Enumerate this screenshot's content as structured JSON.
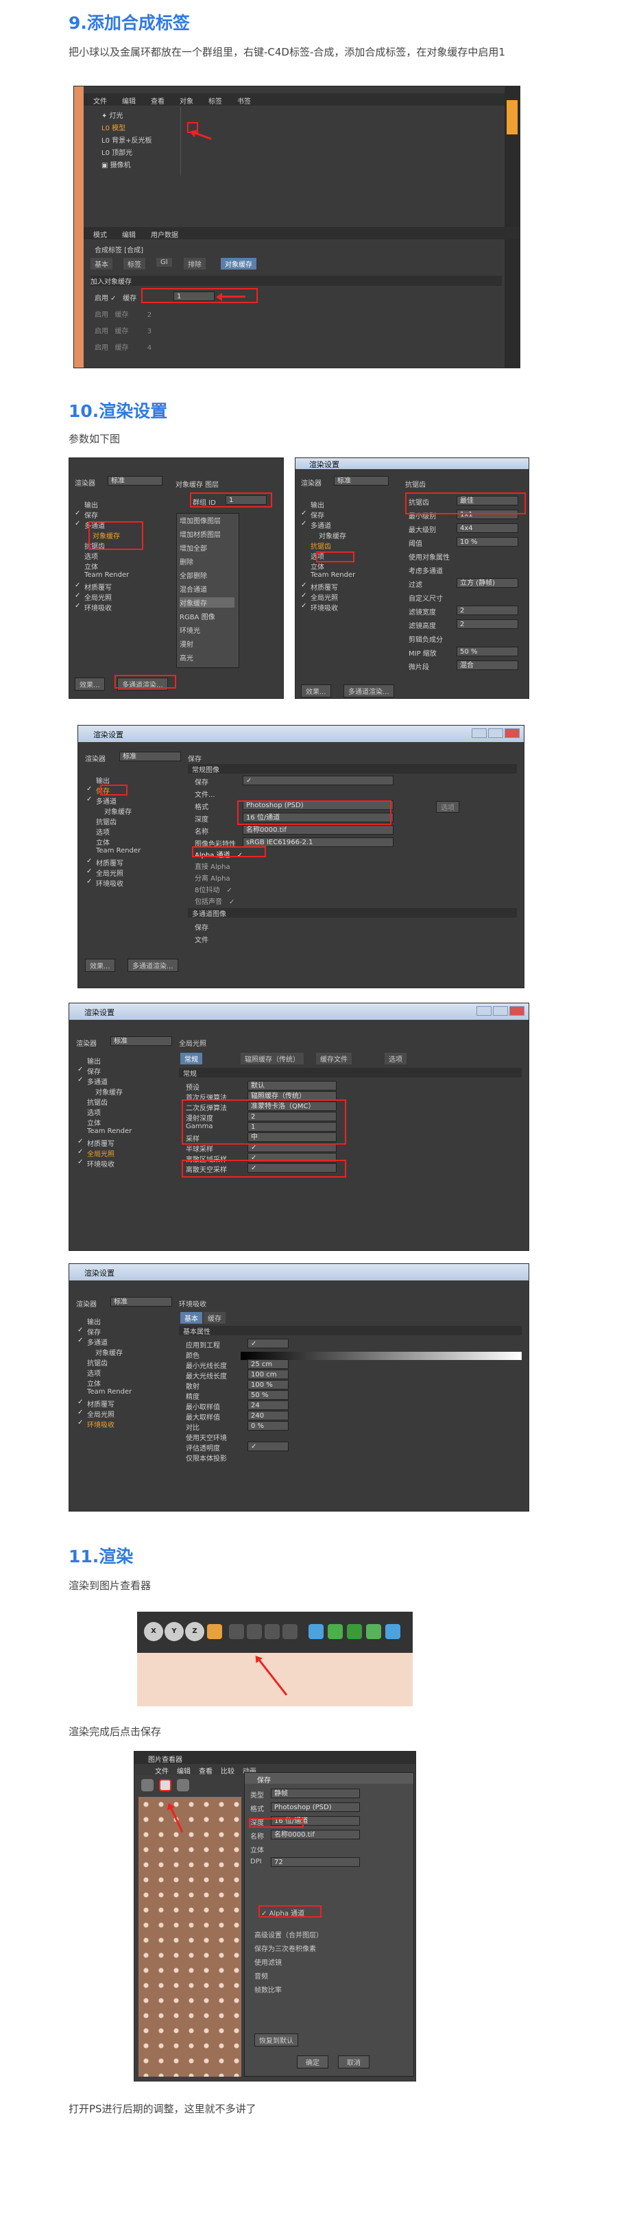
{
  "s9": {
    "title": "9.添加合成标签",
    "desc": "把小球以及金属环都放在一个群组里，右键-C4D标签-合成，添加合成标签，在对象缓存中启用1",
    "menu": [
      "文件",
      "编辑",
      "查看",
      "对象",
      "标签",
      "书签"
    ],
    "objects": [
      "灯光",
      "模型",
      "背景+反光板",
      "顶部光",
      "摄像机"
    ],
    "attr_menu": [
      "模式",
      "编辑",
      "用户数据"
    ],
    "tag_name": "合成标签 [合成]",
    "tabs": [
      "基本",
      "标签",
      "GI",
      "排除",
      "对象缓存"
    ],
    "group_title": "加入对象缓存",
    "cache_rows": [
      {
        "enable": "启用",
        "label": "缓存",
        "value": "1"
      },
      {
        "enable": "启用",
        "label": "缓存",
        "value": "2"
      },
      {
        "enable": "启用",
        "label": "缓存",
        "value": "3"
      },
      {
        "enable": "启用",
        "label": "缓存",
        "value": "4"
      }
    ]
  },
  "s10": {
    "title": "10.渲染设置",
    "desc": "参数如下图",
    "a": {
      "renderer_label": "渲染器",
      "renderer": "标准",
      "items": [
        "输出",
        "保存",
        "多通道",
        "对象缓存",
        "抗锯齿",
        "选项",
        "立体",
        "Team Render",
        "材质覆写",
        "全局光照",
        "环境吸收"
      ],
      "panel_title": "对象缓存 图层",
      "group_label": "群组 ID",
      "group_value": "1",
      "ctx": [
        "增加图像图层",
        "增加材质图层",
        "增加全部",
        "删除",
        "全部删除",
        "混合通道",
        "对象缓存",
        "RGBA 图像",
        "环境光",
        "漫射",
        "高光"
      ],
      "btn_effect": "效果...",
      "btn_multi": "多通道渲染..."
    },
    "b": {
      "title": "渲染设置",
      "renderer_label": "渲染器",
      "renderer": "标准",
      "items": [
        "输出",
        "保存",
        "多通道",
        "对象缓存",
        "抗锯齿",
        "选项",
        "立体",
        "Team Render",
        "材质覆写",
        "全局光照",
        "环境吸收"
      ],
      "panel_title": "抗锯齿",
      "rows": [
        {
          "label": "抗锯齿",
          "value": "最佳"
        },
        {
          "label": "最小级别",
          "value": "1x1"
        },
        {
          "label": "最大级别",
          "value": "4x4"
        },
        {
          "label": "阈值",
          "value": "10 %"
        },
        {
          "label": "使用对象属性",
          "value": ""
        },
        {
          "label": "考虑多通道",
          "value": ""
        },
        {
          "label": "过滤",
          "value": "立方 (静帧)"
        },
        {
          "label": "自定义尺寸",
          "value": ""
        },
        {
          "label": "滤镜宽度",
          "value": "2"
        },
        {
          "label": "滤镜高度",
          "value": "2"
        },
        {
          "label": "剪辑负成分",
          "value": ""
        },
        {
          "label": "MIP 缩放",
          "value": "50 %"
        },
        {
          "label": "微片段",
          "value": "混合"
        }
      ],
      "btn_effect": "效果...",
      "btn_multi": "多通道渲染..."
    },
    "c": {
      "title": "渲染设置",
      "renderer_label": "渲染器",
      "renderer": "标准",
      "items": [
        "输出",
        "保存",
        "多通道",
        "对象缓存",
        "抗锯齿",
        "选项",
        "立体",
        "Team Render",
        "材质覆写",
        "全局光照",
        "环境吸收"
      ],
      "panel_title": "保存",
      "group1": "常规图像",
      "rows": [
        {
          "label": "保存",
          "value": "✓"
        },
        {
          "label": "文件...",
          "value": ""
        },
        {
          "label": "格式",
          "value": "Photoshop (PSD)"
        },
        {
          "label": "深度",
          "value": "16 位/通道"
        },
        {
          "label": "名称",
          "value": "名称0000.tif"
        },
        {
          "label": "图像色彩特性",
          "value": "sRGB IEC61966-2.1"
        }
      ],
      "alpha_rows": [
        "Alpha 通道",
        "直接 Alpha",
        "分离 Alpha",
        "8位抖动",
        "包括声音"
      ],
      "group2": "多通道图像",
      "rows2": [
        "保存",
        "文件"
      ],
      "options_btn": "选项",
      "btn_effect": "效果...",
      "btn_multi": "多通道渲染..."
    },
    "d": {
      "title": "渲染设置",
      "renderer_label": "渲染器",
      "renderer": "标准",
      "items": [
        "输出",
        "保存",
        "多通道",
        "对象缓存",
        "抗锯齿",
        "选项",
        "立体",
        "Team Render",
        "材质覆写",
        "全局光照",
        "环境吸收"
      ],
      "panel_title": "全局光照",
      "tabs": [
        "常规",
        "辐照缓存（传统）",
        "缓存文件",
        "选项"
      ],
      "section": "常规",
      "rows": [
        {
          "label": "预设",
          "value": "默认"
        },
        {
          "label": "首次反弹算法",
          "value": "辐照缓存（传统）"
        },
        {
          "label": "二次反弹算法",
          "value": "准蒙特卡洛（QMC）"
        },
        {
          "label": "漫射深度",
          "value": "2"
        },
        {
          "label": "Gamma",
          "value": "1"
        },
        {
          "label": "采样",
          "value": "中"
        },
        {
          "label": "半球采样",
          "value": "✓"
        },
        {
          "label": "离散区域采样",
          "value": "✓"
        },
        {
          "label": "离散天空采样",
          "value": "✓"
        }
      ]
    },
    "e": {
      "title": "渲染设置",
      "renderer_label": "渲染器",
      "renderer": "标准",
      "items": [
        "输出",
        "保存",
        "多通道",
        "对象缓存",
        "抗锯齿",
        "选项",
        "立体",
        "Team Render",
        "材质覆写",
        "全局光照",
        "环境吸收"
      ],
      "panel_title": "环境吸收",
      "tabs": [
        "基本",
        "缓存"
      ],
      "section": "基本属性",
      "rows": [
        {
          "label": "应用到工程",
          "value": "✓"
        },
        {
          "label": "颜色",
          "value": ""
        },
        {
          "label": "最小光线长度",
          "value": "25 cm"
        },
        {
          "label": "最大光线长度",
          "value": "100 cm"
        },
        {
          "label": "散射",
          "value": "100 %"
        },
        {
          "label": "精度",
          "value": "50 %"
        },
        {
          "label": "最小取样值",
          "value": "24"
        },
        {
          "label": "最大取样值",
          "value": "240"
        },
        {
          "label": "对比",
          "value": "0 %"
        },
        {
          "label": "使用天空环境",
          "value": ""
        },
        {
          "label": "评估透明度",
          "value": "✓"
        },
        {
          "label": "仅限本体投影",
          "value": ""
        }
      ]
    }
  },
  "s11": {
    "title": "11.渲染",
    "desc1": "渲染到图片查看器",
    "desc2": "渲染完成后点击保存",
    "desc3": "打开PS进行后期的调整，这里就不多讲了",
    "viewer_title": "图片查看器",
    "viewer_menu": [
      "文件",
      "编辑",
      "查看",
      "比较",
      "动画"
    ],
    "save_dialog": {
      "title": "保存",
      "rows": [
        {
          "label": "类型",
          "value": "静帧"
        },
        {
          "label": "格式",
          "value": "Photoshop (PSD)"
        },
        {
          "label": "深度",
          "value": "16 位/通道"
        },
        {
          "label": "名称",
          "value": "名称0000.tif"
        },
        {
          "label": "立体",
          "value": ""
        },
        {
          "label": "DPI",
          "value": "72"
        }
      ],
      "alpha": "Alpha 通道",
      "checks": [
        "高级设置（合并图层）",
        "保存为三次卷积像素",
        "使用滤镜",
        "音频",
        "帧数比率"
      ],
      "reset": "恢复到默认",
      "ok": "确定",
      "cancel": "取消"
    }
  }
}
